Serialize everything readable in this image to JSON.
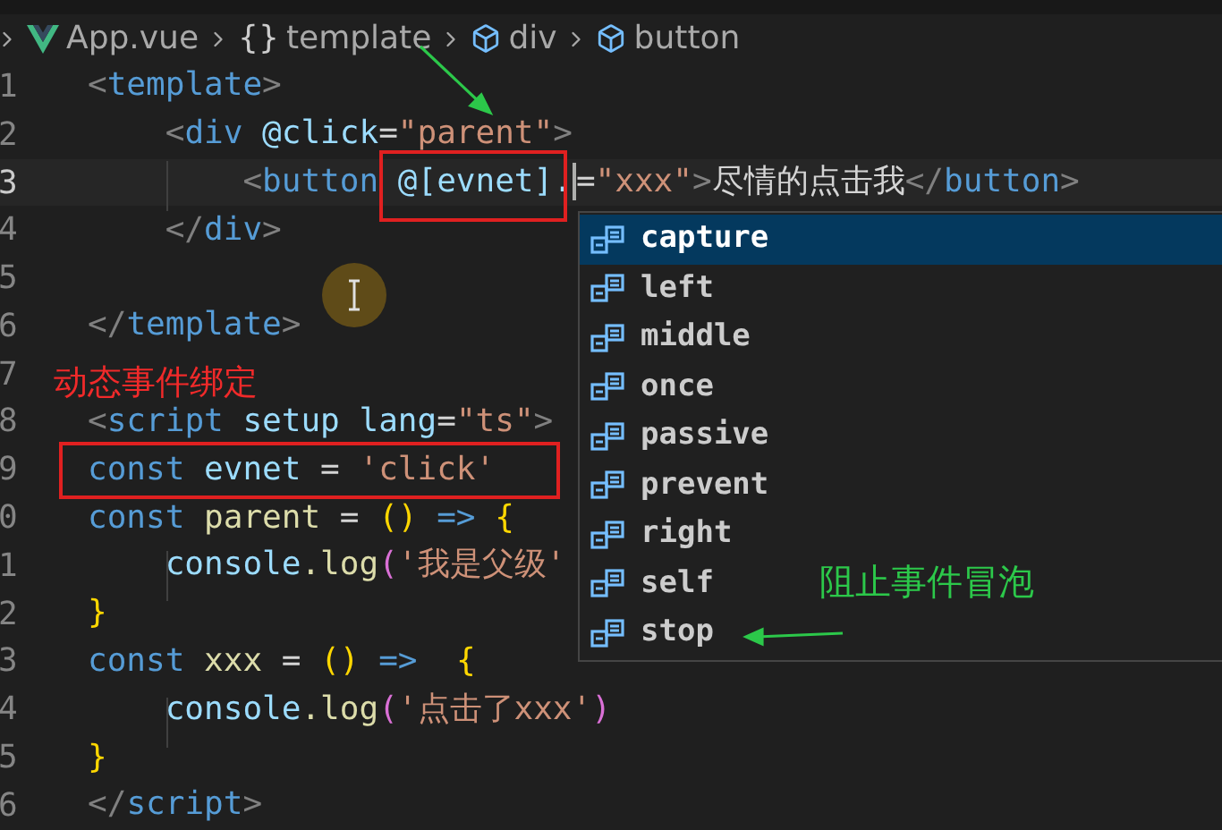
{
  "breadcrumb": [
    {
      "kind": "file",
      "label": "App.vue"
    },
    {
      "kind": "braces",
      "glyph": "{}",
      "label": "template"
    },
    {
      "kind": "element",
      "label": "div"
    },
    {
      "kind": "element",
      "label": "button"
    }
  ],
  "lines": [
    {
      "number": "1",
      "tokens": [
        {
          "kind": "punct",
          "text": "<"
        },
        {
          "kind": "tag",
          "text": "template"
        },
        {
          "kind": "punct",
          "text": ">"
        }
      ]
    },
    {
      "number": "2",
      "tokens": [
        {
          "kind": "punct",
          "text": "    <"
        },
        {
          "kind": "tag",
          "text": "div"
        },
        {
          "kind": "attr",
          "text": " @click"
        },
        {
          "kind": "plain",
          "text": "="
        },
        {
          "kind": "string",
          "text": "\"parent\""
        },
        {
          "kind": "punct",
          "text": ">"
        }
      ]
    },
    {
      "number": "3",
      "current": true,
      "tokens": [
        {
          "kind": "punct",
          "text": "        <"
        },
        {
          "kind": "tag",
          "text": "button"
        },
        {
          "kind": "attr",
          "text": " @[evnet]."
        },
        {
          "kind": "plain",
          "text": "=",
          "caret": true
        },
        {
          "kind": "string",
          "text": "\"xxx\""
        },
        {
          "kind": "punct",
          "text": ">"
        },
        {
          "kind": "plain",
          "text": "尽情的点击我"
        },
        {
          "kind": "punct",
          "text": "</"
        },
        {
          "kind": "tag",
          "text": "button"
        },
        {
          "kind": "punct",
          "text": ">"
        }
      ]
    },
    {
      "number": "4",
      "tokens": [
        {
          "kind": "punct",
          "text": "    </"
        },
        {
          "kind": "tag",
          "text": "div"
        },
        {
          "kind": "punct",
          "text": ">"
        }
      ]
    },
    {
      "number": "5"
    },
    {
      "number": "6",
      "tokens": [
        {
          "kind": "punct",
          "text": "</"
        },
        {
          "kind": "tag",
          "text": "template"
        },
        {
          "kind": "punct",
          "text": ">"
        }
      ]
    },
    {
      "number": "7"
    },
    {
      "number": "8",
      "tokens": [
        {
          "kind": "punct",
          "text": "<"
        },
        {
          "kind": "tag",
          "text": "script"
        },
        {
          "kind": "attr",
          "text": " setup lang"
        },
        {
          "kind": "plain",
          "text": "="
        },
        {
          "kind": "string",
          "text": "\"ts\""
        },
        {
          "kind": "punct",
          "text": ">"
        }
      ]
    },
    {
      "number": "9",
      "tokens": [
        {
          "kind": "keyword",
          "text": "const"
        },
        {
          "kind": "var",
          "text": " evnet"
        },
        {
          "kind": "plain",
          "text": " = "
        },
        {
          "kind": "string",
          "text": "'click'"
        }
      ]
    },
    {
      "number": "0",
      "tokens": [
        {
          "kind": "keyword",
          "text": "const"
        },
        {
          "kind": "func",
          "text": " parent"
        },
        {
          "kind": "plain",
          "text": " = "
        },
        {
          "kind": "bracket",
          "text": "()"
        },
        {
          "kind": "keyword",
          "text": " =>"
        },
        {
          "kind": "bracket",
          "text": " {"
        }
      ]
    },
    {
      "number": "1",
      "tokens": [
        {
          "kind": "var",
          "text": "    console"
        },
        {
          "kind": "func",
          "text": ".log"
        },
        {
          "kind": "bracket2",
          "text": "("
        },
        {
          "kind": "string",
          "text": "'我是父级'"
        }
      ]
    },
    {
      "number": "2",
      "tokens": [
        {
          "kind": "bracket",
          "text": "}"
        }
      ]
    },
    {
      "number": "3",
      "tokens": [
        {
          "kind": "keyword",
          "text": "const"
        },
        {
          "kind": "func",
          "text": " xxx"
        },
        {
          "kind": "plain",
          "text": " = "
        },
        {
          "kind": "bracket",
          "text": "()"
        },
        {
          "kind": "keyword",
          "text": " =>"
        },
        {
          "kind": "bracket",
          "text": "  {"
        }
      ]
    },
    {
      "number": "4",
      "tokens": [
        {
          "kind": "var",
          "text": "    console"
        },
        {
          "kind": "func",
          "text": ".log"
        },
        {
          "kind": "bracket2",
          "text": "("
        },
        {
          "kind": "string",
          "text": "'点击了xxx'"
        },
        {
          "kind": "bracket2",
          "text": ")"
        }
      ]
    },
    {
      "number": "5",
      "tokens": [
        {
          "kind": "bracket",
          "text": "}"
        }
      ]
    },
    {
      "number": "6",
      "tokens": [
        {
          "kind": "punct",
          "text": "</"
        },
        {
          "kind": "tag",
          "text": "script"
        },
        {
          "kind": "punct",
          "text": ">"
        }
      ]
    }
  ],
  "suggestions": [
    {
      "label": "capture",
      "selected": true
    },
    {
      "label": "left",
      "selected": false
    },
    {
      "label": "middle",
      "selected": false
    },
    {
      "label": "once",
      "selected": false
    },
    {
      "label": "passive",
      "selected": false
    },
    {
      "label": "prevent",
      "selected": false
    },
    {
      "label": "right",
      "selected": false
    },
    {
      "label": "self",
      "selected": false
    },
    {
      "label": "stop",
      "selected": false
    }
  ],
  "annotations": [
    {
      "kind": "red-note",
      "text": "动态事件绑定"
    },
    {
      "kind": "green-note",
      "text": "阻止事件冒泡"
    }
  ]
}
